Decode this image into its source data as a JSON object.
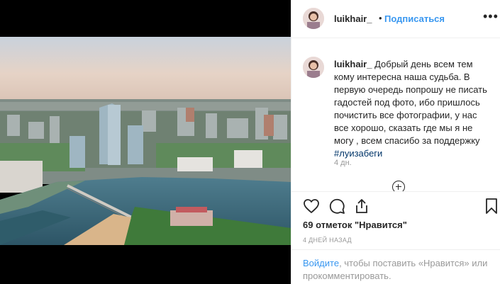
{
  "header": {
    "username": "luikhair_",
    "dot": "•",
    "follow_label": "Подписаться",
    "more": "•••"
  },
  "caption": {
    "username": "luikhair_",
    "text": "Добрый день всем тем кому интересна наша судьба. В первую очередь попрошу не писать гадостей под фото, ибо пришлось почистить все фотографии, у нас все хорошо, сказать где мы я не могу , всем спасибо за поддержку",
    "hashtag": "#луизабеги",
    "time": "4 дн."
  },
  "stats": {
    "likes": "69 отметок \"Нравится\"",
    "date": "4 ДНЕЙ НАЗАД"
  },
  "login": {
    "link": "Войдите",
    "text": ", чтобы поставить «Нравится» или прокомментировать."
  },
  "icons": {
    "like": "heart-icon",
    "comment": "comment-icon",
    "share": "share-icon",
    "save": "bookmark-icon",
    "load_more": "plus-circle-icon"
  },
  "colors": {
    "accent": "#3897f0",
    "text": "#262626",
    "muted": "#999999"
  }
}
